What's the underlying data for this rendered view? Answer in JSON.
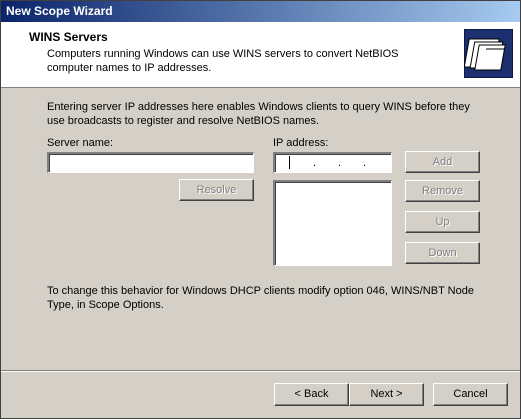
{
  "window": {
    "title": "New Scope Wizard"
  },
  "header": {
    "title": "WINS Servers",
    "description": "Computers running Windows can use WINS servers to convert NetBIOS computer names to IP addresses."
  },
  "intro": "Entering server IP addresses here enables Windows clients to query WINS before they use broadcasts to register and resolve NetBIOS names.",
  "server_name": {
    "label": "Server name:",
    "value": ""
  },
  "ip_address": {
    "label": "IP address:",
    "value": ""
  },
  "buttons": {
    "resolve": "Resolve",
    "add": "Add",
    "remove": "Remove",
    "up": "Up",
    "down": "Down"
  },
  "ip_list": [],
  "bottom_note": "To change this behavior for Windows DHCP clients modify option 046, WINS/NBT Node Type, in Scope Options.",
  "footer": {
    "back": "< Back",
    "next": "Next >",
    "cancel": "Cancel"
  },
  "colors": {
    "titlebar_start": "#0a246a",
    "titlebar_end": "#a6caf0",
    "dialog_bg": "#d4d0c8"
  },
  "icons": {
    "header": "folders-icon"
  }
}
